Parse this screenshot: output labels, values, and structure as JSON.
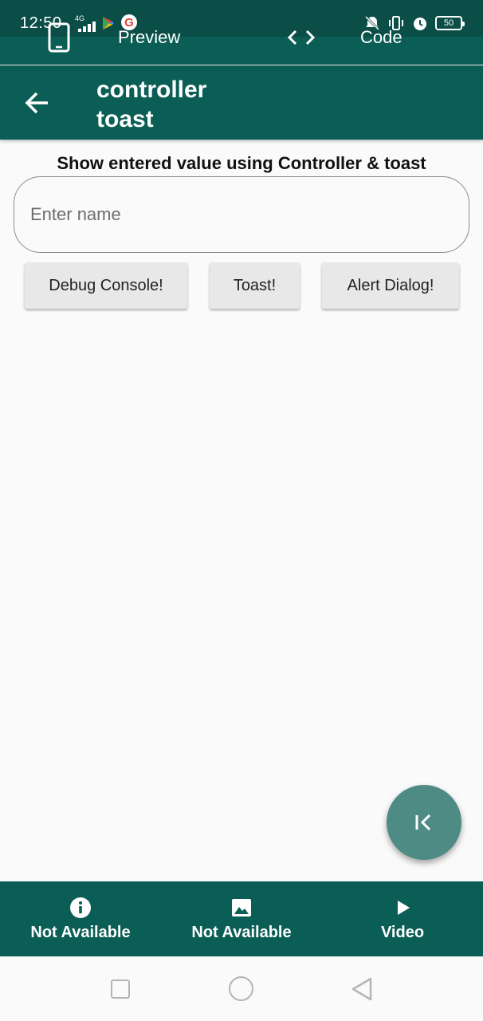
{
  "status_bar": {
    "time": "12:50",
    "network": "4G",
    "battery": "50"
  },
  "top_toolbar": {
    "preview_label": "Preview",
    "code_label": "Code"
  },
  "app_bar": {
    "title": "controller toast"
  },
  "main": {
    "heading": "Show entered value using Controller & toast",
    "name_input": {
      "placeholder": "Enter name",
      "value": ""
    },
    "buttons": {
      "debug": "Debug Console!",
      "toast": "Toast!",
      "alert": "Alert Dialog!"
    }
  },
  "bottom_nav": {
    "items": [
      {
        "label": "Not Available",
        "icon": "info-icon"
      },
      {
        "label": "Not Available",
        "icon": "image-icon"
      },
      {
        "label": "Video",
        "icon": "play-icon"
      }
    ]
  },
  "colors": {
    "primary": "#0b5e55",
    "fab": "#4d8b84",
    "background": "#fafafa"
  }
}
